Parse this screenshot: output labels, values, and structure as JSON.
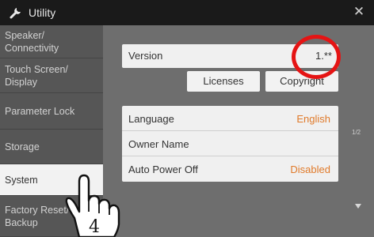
{
  "window": {
    "title": "Utility"
  },
  "sidebar": {
    "items": [
      {
        "line1": "Speaker/",
        "line2": "Connectivity",
        "active": false
      },
      {
        "line1": "Touch Screen/",
        "line2": "Display",
        "active": false
      },
      {
        "line1": "Parameter Lock",
        "line2": "",
        "active": false
      },
      {
        "line1": "Storage",
        "line2": "",
        "active": false
      },
      {
        "line1": "System",
        "line2": "",
        "active": true
      },
      {
        "line1": "Factory Reset/",
        "line2": "Backup",
        "active": false
      }
    ]
  },
  "main": {
    "version": {
      "label": "Version",
      "value": "1.**"
    },
    "buttons": {
      "licenses": "Licenses",
      "copyright": "Copyright"
    },
    "settings": [
      {
        "label": "Language",
        "value": "English"
      },
      {
        "label": "Owner Name",
        "value": ""
      },
      {
        "label": "Auto Power Off",
        "value": "Disabled"
      }
    ],
    "page_indicator": "1/2"
  },
  "annotation": {
    "step_number": "4"
  },
  "colors": {
    "accent": "#e07a2a",
    "annotation": "#e51414"
  },
  "icons": {
    "title": "wrench-icon",
    "close": "close-icon",
    "scroll": "scroll-down-icon"
  }
}
